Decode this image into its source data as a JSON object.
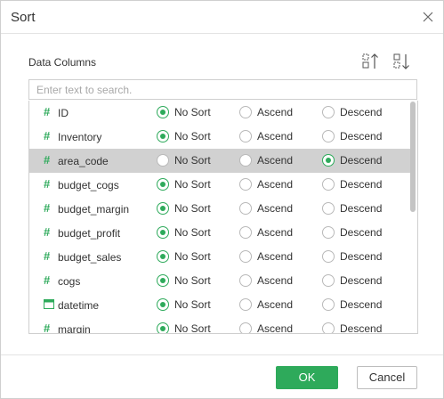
{
  "dialog": {
    "title": "Sort",
    "close_icon": "close-icon"
  },
  "data_columns": {
    "label": "Data Columns",
    "toolbar": {
      "sort_ascending_icon": "sort-ascending-icon",
      "sort_descending_icon": "sort-descending-icon"
    },
    "search": {
      "placeholder": "Enter text to search.",
      "value": ""
    },
    "options": [
      "No Sort",
      "Ascend",
      "Descend"
    ],
    "columns": [
      {
        "name": "ID",
        "type_icon": "numeric-icon",
        "sort": "No Sort",
        "selected": false
      },
      {
        "name": "Inventory",
        "type_icon": "numeric-icon",
        "sort": "No Sort",
        "selected": false
      },
      {
        "name": "area_code",
        "type_icon": "numeric-icon",
        "sort": "Descend",
        "selected": true
      },
      {
        "name": "budget_cogs",
        "type_icon": "numeric-icon",
        "sort": "No Sort",
        "selected": false
      },
      {
        "name": "budget_margin",
        "type_icon": "numeric-icon",
        "sort": "No Sort",
        "selected": false
      },
      {
        "name": "budget_profit",
        "type_icon": "numeric-icon",
        "sort": "No Sort",
        "selected": false
      },
      {
        "name": "budget_sales",
        "type_icon": "numeric-icon",
        "sort": "No Sort",
        "selected": false
      },
      {
        "name": "cogs",
        "type_icon": "numeric-icon",
        "sort": "No Sort",
        "selected": false
      },
      {
        "name": "datetime",
        "type_icon": "calendar-icon",
        "sort": "No Sort",
        "selected": false
      },
      {
        "name": "margin",
        "type_icon": "numeric-icon",
        "sort": "No Sort",
        "selected": false
      }
    ]
  },
  "footer": {
    "ok_label": "OK",
    "cancel_label": "Cancel"
  },
  "colors": {
    "accent": "#2eaa5b",
    "selected_row": "#d1d1d1",
    "border": "#cfcfcf"
  }
}
